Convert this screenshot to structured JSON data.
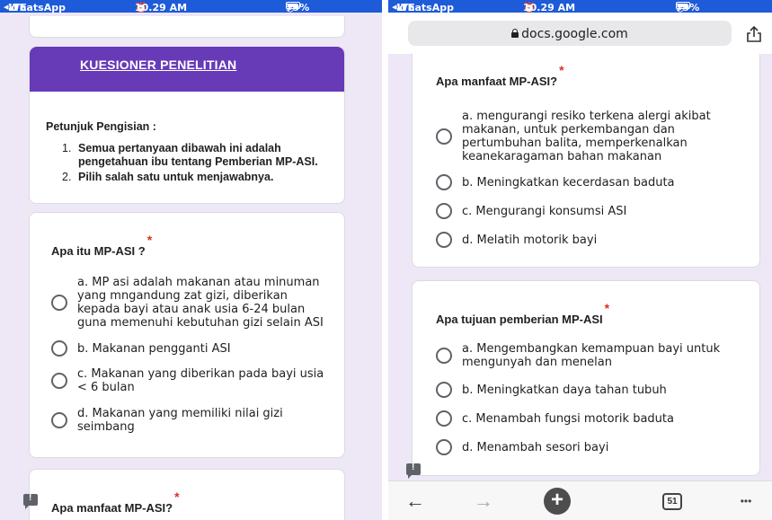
{
  "status_bar": {
    "app": "WhatsApp",
    "network": "LTE",
    "time": "10.29 AM",
    "battery": "79%"
  },
  "browser": {
    "url": "docs.google.com"
  },
  "form": {
    "header_title": "KUESIONER PENELITIAN",
    "instructions_title": "Petunjuk Pengisian :",
    "instructions": [
      {
        "num": "1.",
        "text": "Semua pertanyaan dibawah ini adalah pengetahuan ibu tentang Pemberian MP-ASI."
      },
      {
        "num": "2.",
        "text": "Pilih salah satu untuk menjawabnya."
      }
    ],
    "required_marker": "*",
    "q1": {
      "title": "Apa itu MP-ASI ?",
      "options": [
        "a. MP asi adalah makanan atau minuman yang mngandung zat gizi, diberikan kepada bayi atau anak usia 6-24 bulan guna memenuhi kebutuhan gizi selain ASI",
        "b. Makanan pengganti ASI",
        "c. Makanan yang diberikan pada bayi usia < 6 bulan",
        "d. Makanan yang memiliki nilai gizi seimbang"
      ]
    },
    "q2": {
      "title": "Apa manfaat MP-ASI?",
      "options": [
        "a. mengurangi resiko terkena alergi akibat makanan, untuk perkembangan dan pertumbuhan balita, memperkenalkan keanekaragaman bahan makanan",
        "b. Meningkatkan kecerdasan baduta",
        "c. Mengurangi konsumsi ASI",
        "d. Melatih motorik bayi"
      ]
    },
    "q3": {
      "title": "Apa tujuan pemberian MP-ASI",
      "options": [
        "a. Mengembangkan kemampuan bayi untuk mengunyah dan menelan",
        "b. Meningkatkan daya tahan tubuh",
        "c. Menambah fungsi motorik baduta",
        "d. Menambah sesori bayi"
      ]
    }
  },
  "toolbar": {
    "back": "←",
    "forward": "→",
    "new_tab": "+",
    "tab_count": "51",
    "more": "•••"
  },
  "colors": {
    "status_bar": "#1e5bd8",
    "form_accent": "#673ab7",
    "required": "#d93025",
    "background": "#ede7f6"
  }
}
